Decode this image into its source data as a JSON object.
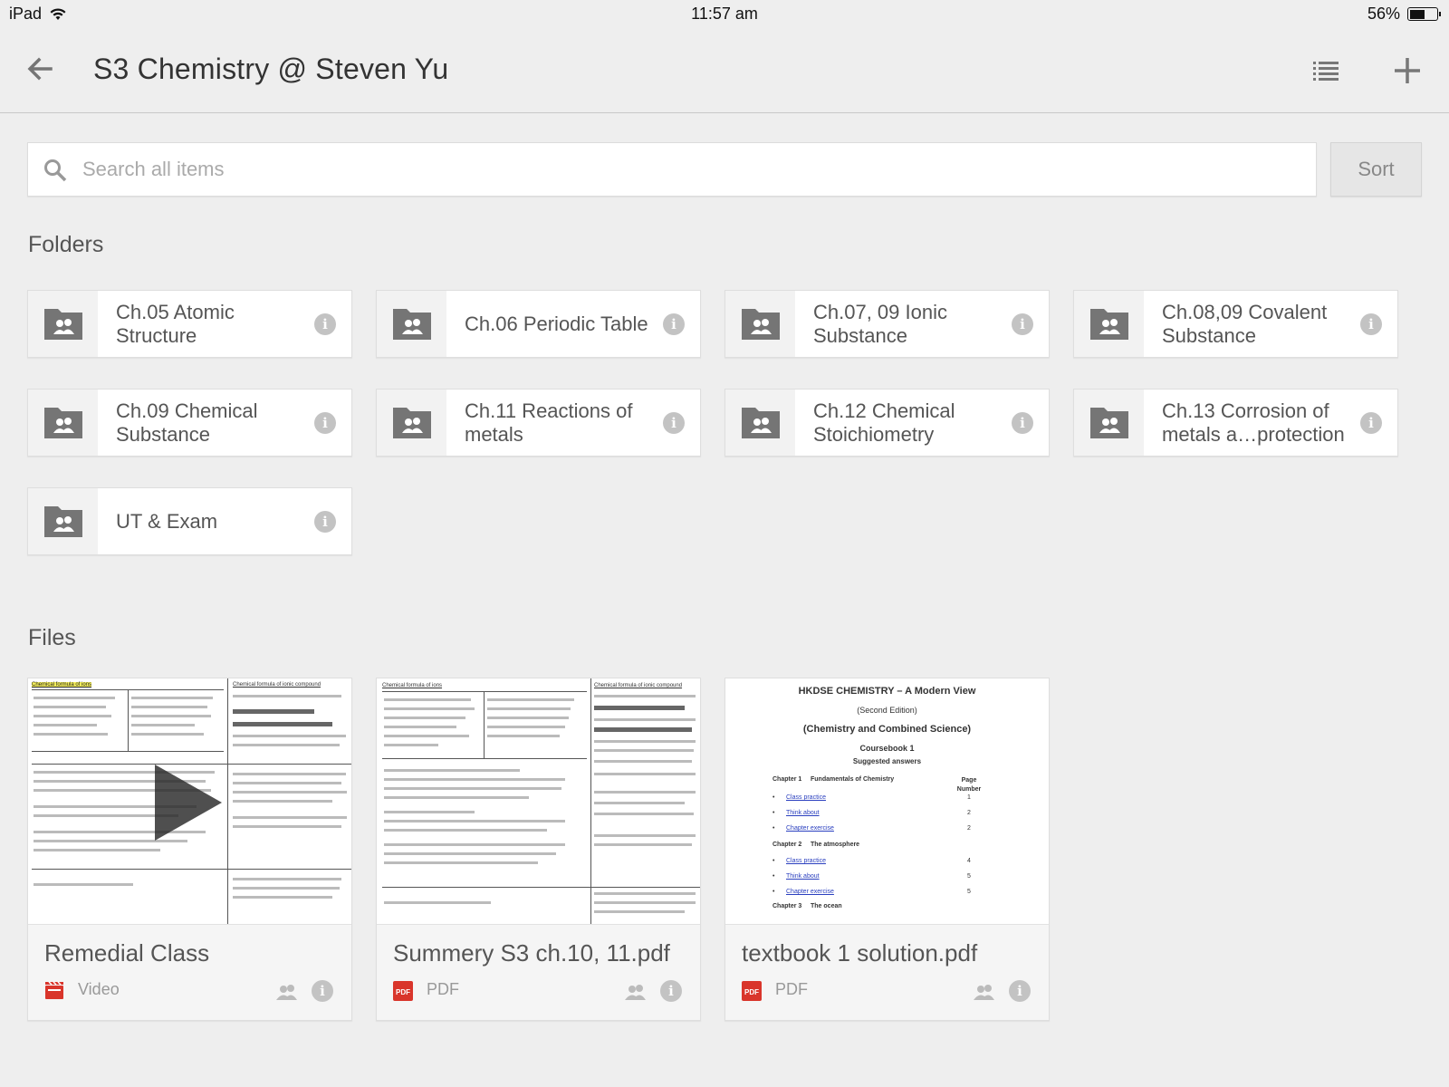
{
  "status_bar": {
    "device": "iPad",
    "time": "11:57 am",
    "battery": "56%",
    "battery_level": 0.56
  },
  "header": {
    "title": "S3 Chemistry @ Steven Yu"
  },
  "search": {
    "placeholder": "Search all items",
    "sort_label": "Sort"
  },
  "folders_section": {
    "title": "Folders",
    "items": [
      {
        "name": "Ch.05 Atomic Structure"
      },
      {
        "name": "Ch.06 Periodic Table"
      },
      {
        "name": "Ch.07, 09 Ionic Substance"
      },
      {
        "name": "Ch.08,09 Covalent Substance"
      },
      {
        "name": "Ch.09 Chemical Substance"
      },
      {
        "name": "Ch.11 Reactions of metals"
      },
      {
        "name": "Ch.12 Chemical Stoichiometry"
      },
      {
        "name": "Ch.13 Corrosion of metals a…protection"
      },
      {
        "name": "UT & Exam"
      }
    ]
  },
  "files_section": {
    "title": "Files",
    "items": [
      {
        "name": "Remedial Class",
        "type": "Video",
        "icon": "video-icon"
      },
      {
        "name": "Summery S3 ch.10, 11.pdf",
        "type": "PDF",
        "icon": "pdf-icon"
      },
      {
        "name": "textbook 1 solution.pdf",
        "type": "PDF",
        "icon": "pdf-icon"
      }
    ]
  },
  "thumbnails": {
    "doc_heading_1": "Chemical formula of ions",
    "doc_heading_2": "Chemical formula of ionic compound",
    "textbook": {
      "title": "HKDSE CHEMISTRY – A Modern View",
      "edition": "(Second Edition)",
      "subtitle": "(Chemistry and Combined Science)",
      "book": "Coursebook 1",
      "answers": "Suggested answers",
      "ch1": "Chapter 1     Fundamentals of Chemistry",
      "page_header": "Page Number",
      "ch1_items": [
        {
          "label": "Class practice",
          "page": "1"
        },
        {
          "label": "Think about",
          "page": "2"
        },
        {
          "label": "Chapter exercise",
          "page": "2"
        }
      ],
      "ch2": "Chapter 2     The atmosphere",
      "ch2_items": [
        {
          "label": "Class practice",
          "page": "4"
        },
        {
          "label": "Think about",
          "page": "5"
        },
        {
          "label": "Chapter exercise",
          "page": "5"
        }
      ],
      "ch3": "Chapter 3     The ocean"
    }
  },
  "colors": {
    "background": "#eeeeee",
    "pdf_red": "#d9352b",
    "icon_grey": "#757575"
  }
}
